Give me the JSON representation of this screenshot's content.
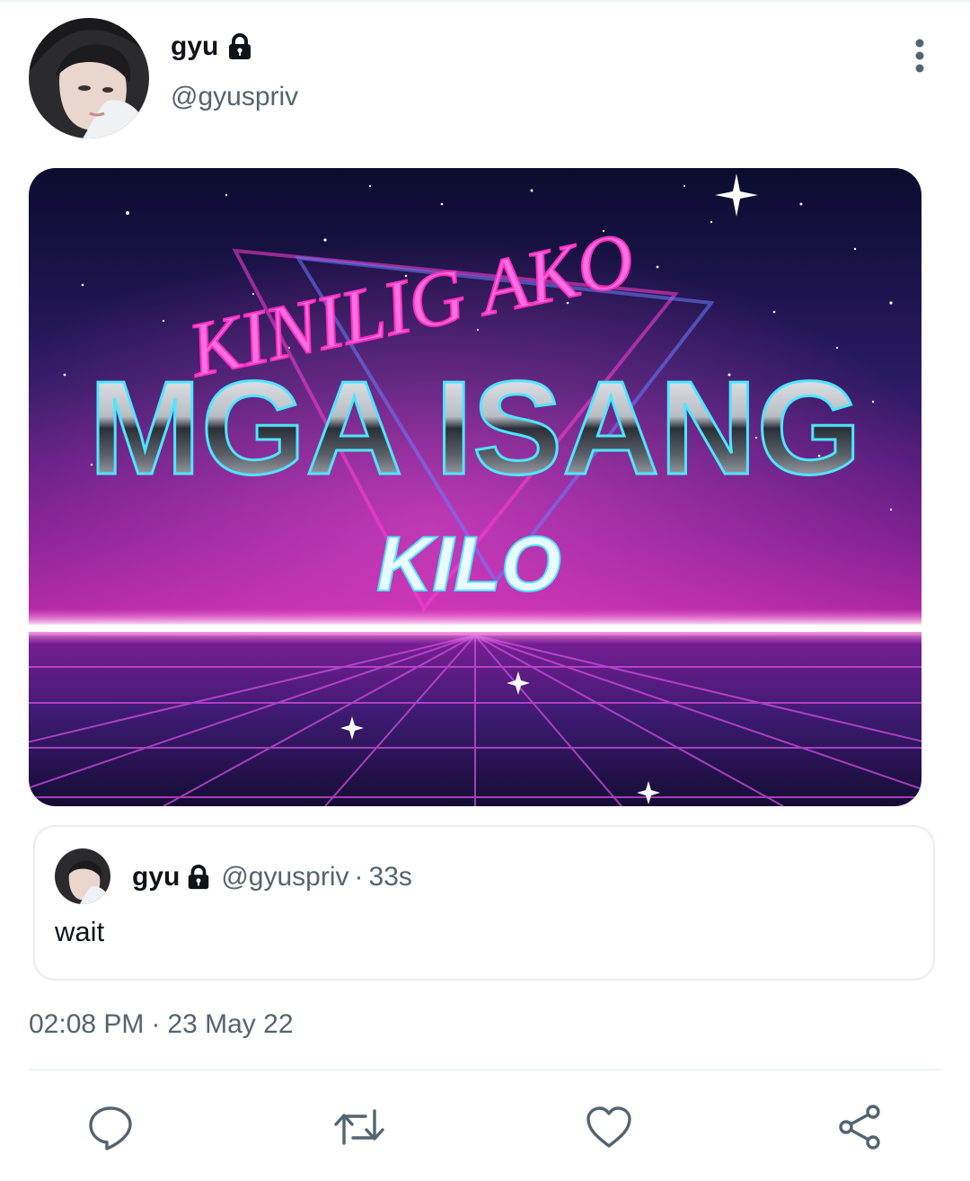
{
  "tweet": {
    "author": {
      "display_name": "gyu",
      "handle": "@gyuspriv",
      "protected": true,
      "avatar": "avatar-photo"
    },
    "more_icon": "more-vertical-icon",
    "media": {
      "lines": [
        "KINILIG AKO",
        "MGA ISANG",
        "KILO"
      ],
      "style": "retro-80s-neon"
    },
    "quoted": {
      "display_name": "gyu",
      "handle": "@gyuspriv",
      "separator": "·",
      "time": "33s",
      "text": "wait"
    },
    "timestamp": {
      "time": "02:08 PM",
      "separator": "·",
      "date": "23 May 22"
    },
    "actions": [
      {
        "name": "reply",
        "icon": "reply-icon"
      },
      {
        "name": "retweet",
        "icon": "retweet-icon"
      },
      {
        "name": "like",
        "icon": "heart-icon"
      },
      {
        "name": "share",
        "icon": "share-icon"
      }
    ]
  },
  "colors": {
    "text_primary": "#0f1419",
    "text_secondary": "#536471",
    "icon": "#536471",
    "border": "#e8ecee",
    "neon_pink": "#ff3fd2",
    "neon_cyan": "#4ee6ff"
  }
}
